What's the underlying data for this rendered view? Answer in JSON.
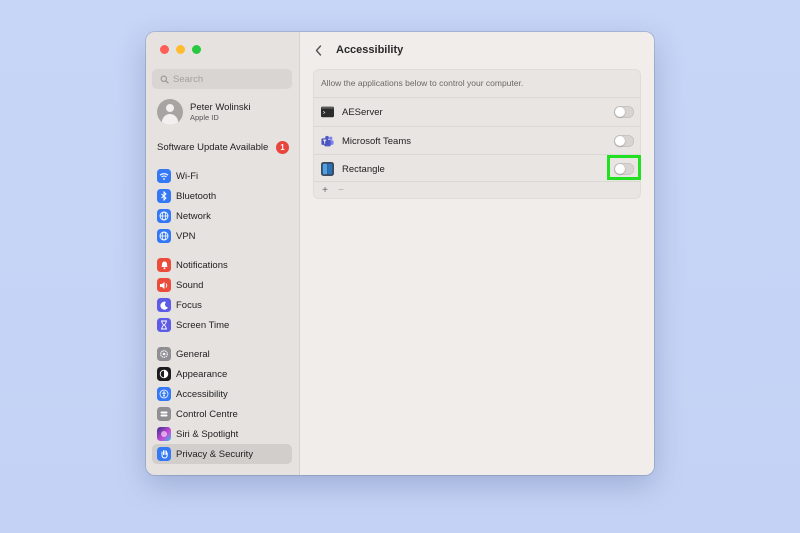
{
  "window": {
    "traffic_lights": [
      "close",
      "minimize",
      "zoom"
    ]
  },
  "sidebar": {
    "search": {
      "placeholder": "Search",
      "value": ""
    },
    "profile": {
      "name": "Peter Wolinski",
      "subtitle": "Apple ID"
    },
    "update": {
      "label": "Software Update Available",
      "badge_count": "1"
    },
    "groups": [
      [
        {
          "label": "Wi-Fi",
          "icon": "wifi-icon",
          "color": "#3478f6"
        },
        {
          "label": "Bluetooth",
          "icon": "bluetooth-icon",
          "color": "#3478f6"
        },
        {
          "label": "Network",
          "icon": "globe-icon",
          "color": "#3478f6"
        },
        {
          "label": "VPN",
          "icon": "vpn-globe-icon",
          "color": "#3478f6"
        }
      ],
      [
        {
          "label": "Notifications",
          "icon": "bell-icon",
          "color": "#eb4d3d"
        },
        {
          "label": "Sound",
          "icon": "speaker-icon",
          "color": "#eb4d3d"
        },
        {
          "label": "Focus",
          "icon": "moon-icon",
          "color": "#5e5ce6"
        },
        {
          "label": "Screen Time",
          "icon": "hourglass-icon",
          "color": "#5e5ce6"
        }
      ],
      [
        {
          "label": "General",
          "icon": "gear-icon",
          "color": "#8e8e93"
        },
        {
          "label": "Appearance",
          "icon": "appearance-icon",
          "color": "#1c1c1e"
        },
        {
          "label": "Accessibility",
          "icon": "accessibility-icon",
          "color": "#3478f6"
        },
        {
          "label": "Control Centre",
          "icon": "control-centre-icon",
          "color": "#8e8e93"
        },
        {
          "label": "Siri & Spotlight",
          "icon": "siri-icon",
          "color": "#7a3fd6"
        },
        {
          "label": "Privacy & Security",
          "icon": "hand-icon",
          "color": "#3478f6",
          "selected": true
        }
      ]
    ]
  },
  "main": {
    "title": "Accessibility",
    "description": "Allow the applications below to control your computer.",
    "apps": [
      {
        "label": "AEServer",
        "icon": "terminal-icon",
        "enabled": false
      },
      {
        "label": "Microsoft Teams",
        "icon": "teams-icon",
        "enabled": false
      },
      {
        "label": "Rectangle",
        "icon": "rectangle-app-icon",
        "enabled": false,
        "highlighted": true
      }
    ],
    "footer": {
      "add": "+",
      "remove": "−"
    }
  },
  "colors": {
    "highlight": "#20e020",
    "sidebar_bg": "#e6e2e0",
    "main_bg": "#f1edeb",
    "desktop_bg": "#c7d5f6"
  }
}
